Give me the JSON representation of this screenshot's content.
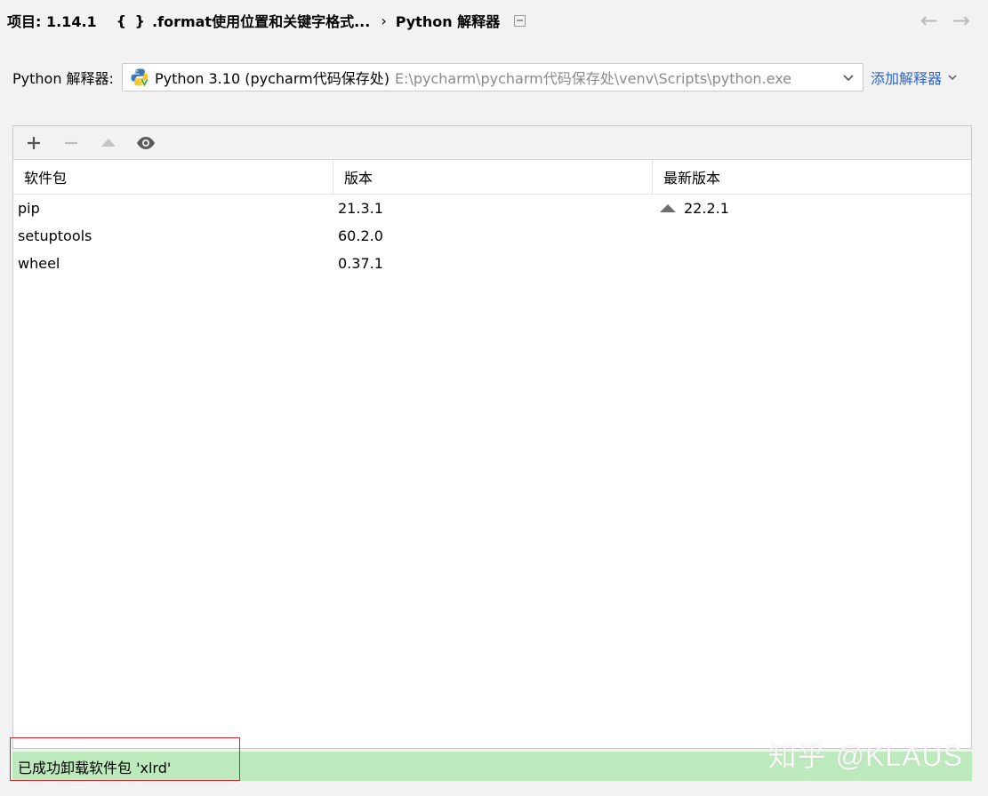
{
  "breadcrumb": {
    "project": "项目: 1.14.1",
    "braces": "{ }",
    "file": ".format使用位置和关键字格式...",
    "chevron": "›",
    "page": "Python 解释器"
  },
  "nav": {
    "back_icon": "←",
    "forward_icon": "→"
  },
  "interpreter": {
    "label": "Python 解释器:",
    "name": "Python 3.10 (pycharm代码保存处)",
    "path": "E:\\pycharm\\pycharm代码保存处\\venv\\Scripts\\python.exe",
    "add_label": "添加解释器"
  },
  "toolbar": {
    "add_icon": "plus-icon",
    "remove_icon": "minus-icon",
    "upgrade_icon": "up-triangle-icon",
    "show_icon": "eye-icon"
  },
  "table": {
    "headers": [
      "软件包",
      "版本",
      "最新版本"
    ],
    "rows": [
      {
        "package": "pip",
        "version": "21.3.1",
        "latest": "22.2.1",
        "upgrade": true
      },
      {
        "package": "setuptools",
        "version": "60.2.0",
        "latest": "",
        "upgrade": false
      },
      {
        "package": "wheel",
        "version": "0.37.1",
        "latest": "",
        "upgrade": false
      }
    ]
  },
  "status": {
    "message": "已成功卸载软件包 'xlrd'"
  },
  "watermark": "知乎 @KLAUS",
  "colors": {
    "status_bg": "#bdeabd",
    "link": "#2f65ca",
    "highlight": "#d0262a"
  }
}
